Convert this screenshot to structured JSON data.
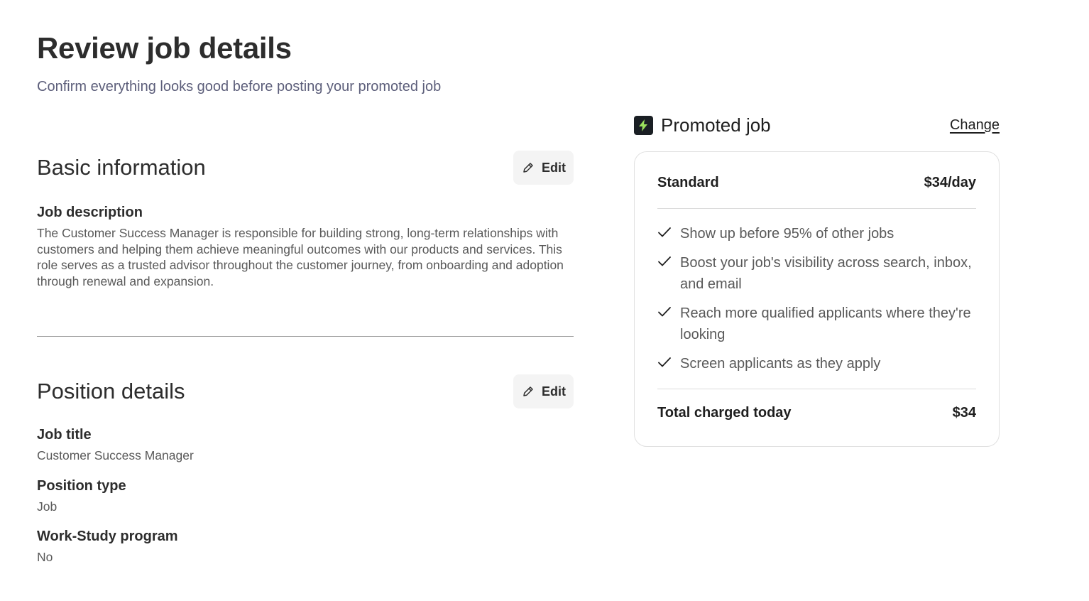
{
  "header": {
    "title": "Review job details",
    "subtitle": "Confirm everything looks good before posting your promoted job"
  },
  "basic_information": {
    "title": "Basic information",
    "edit_label": "Edit",
    "job_description_label": "Job description",
    "job_description": "The Customer Success Manager is responsible for building strong, long-term relationships with customers and helping them achieve meaningful outcomes with our products and services. This role serves as a trusted advisor throughout the customer journey, from onboarding and adoption through renewal and expansion."
  },
  "position_details": {
    "title": "Position details",
    "edit_label": "Edit",
    "fields": [
      {
        "label": "Job title",
        "value": "Customer Success Manager"
      },
      {
        "label": "Position type",
        "value": "Job"
      },
      {
        "label": "Work-Study program",
        "value": "No"
      }
    ]
  },
  "promoted_job": {
    "title": "Promoted job",
    "change_label": "Change",
    "icon": "lightning-bolt-icon",
    "accent_color": "#9be15d",
    "plan_name": "Standard",
    "plan_price": "$34/day",
    "benefits": [
      "Show up before 95% of other jobs",
      "Boost your job's visibility across search, inbox, and email",
      "Reach more qualified applicants where they're looking",
      "Screen applicants as they apply"
    ],
    "total_label": "Total charged today",
    "total_amount": "$34"
  }
}
